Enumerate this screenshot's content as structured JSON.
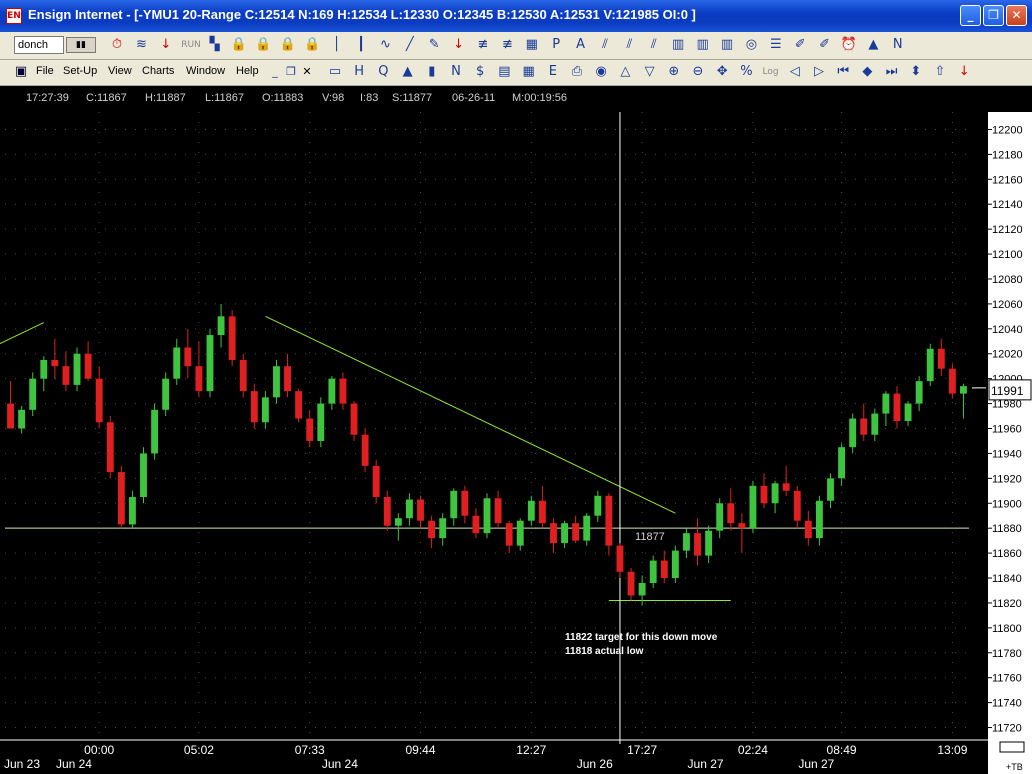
{
  "window": {
    "title": "Ensign Internet - [-YMU1 20-Range C:12514 N:169 H:12534 L:12330 O:12345 B:12530 A:12531 V:121985 OI:0 ]",
    "icon_text": "EN"
  },
  "toolbar1": {
    "symbol_value": "donch",
    "icons": [
      "stopwatch-icon",
      "wave-icon",
      "arrow-down-red-icon",
      "run-icon",
      "network-icon",
      "lock-icon",
      "lock-icon",
      "lock-icon",
      "lock-icon",
      "vertical-line-icon",
      "candle-icon",
      "curve-icon",
      "line-icon",
      "pencil-icon",
      "arrow-down-icon",
      "fib-icon",
      "fib-icon",
      "grid-icon",
      "p-box-icon",
      "a-box-icon",
      "lines-icon",
      "lines-icon",
      "lines-icon",
      "bars-icon",
      "bars-icon",
      "bars-icon",
      "target-icon",
      "list-icon",
      "pen-icon",
      "pen-icon",
      "alarm-icon",
      "triangle-icon",
      "n-icon"
    ],
    "run_label": "RUN"
  },
  "menubar": {
    "items": [
      "File",
      "Set-Up",
      "View",
      "Charts",
      "Window",
      "Help"
    ],
    "icons": [
      "window-icon",
      "h-icon",
      "q-icon",
      "fire-icon",
      "bar-icon",
      "n-icon",
      "dollar-icon",
      "book-icon",
      "grid-icon",
      "espl-icon",
      "print-icon",
      "color-icon",
      "triangle-up-icon",
      "triangle-down-icon",
      "zoom-in-icon",
      "zoom-out-icon",
      "drag-icon",
      "percent-icon",
      "log-icon",
      "scroll-left-icon",
      "scroll-right-icon",
      "first-icon",
      "arrows-lr-icon",
      "last-icon",
      "arrows-ud-icon",
      "arrow-up-icon",
      "arrow-down-icon"
    ],
    "log_label": "Log"
  },
  "infobar": {
    "time": "17:27:39",
    "close": "C:11867",
    "high": "H:11887",
    "low": "L:11867",
    "open": "O:11883",
    "volume": "V:98",
    "i": "I:83",
    "s": "S:11877",
    "date": "06-26-11",
    "m": "M:00:19:56"
  },
  "chart_data": {
    "type": "candlestick",
    "ylim": [
      11710,
      12210
    ],
    "y_ticks": [
      12200,
      12180,
      12160,
      12140,
      12120,
      12100,
      12080,
      12060,
      12040,
      12020,
      12000,
      11980,
      11960,
      11940,
      11920,
      11900,
      11880,
      11860,
      11840,
      11820,
      11800,
      11780,
      11760,
      11740,
      11720
    ],
    "time_labels": [
      {
        "bar": 8,
        "label": "00:00"
      },
      {
        "bar": 17,
        "label": "05:02"
      },
      {
        "bar": 27,
        "label": "07:33"
      },
      {
        "bar": 37,
        "label": "09:44"
      },
      {
        "bar": 47,
        "label": "12:27"
      },
      {
        "bar": 57,
        "label": "17:27"
      },
      {
        "bar": 67,
        "label": "02:24"
      },
      {
        "bar": 75,
        "label": "08:49"
      },
      {
        "bar": 85,
        "label": "13:09"
      }
    ],
    "date_labels": [
      {
        "bar": 0,
        "label": "Jun 23"
      },
      {
        "bar": 5,
        "label": "Jun 24"
      },
      {
        "bar": 29,
        "label": "Jun 24"
      },
      {
        "bar": 52,
        "label": "Jun 26"
      },
      {
        "bar": 62,
        "label": "Jun 27"
      },
      {
        "bar": 72,
        "label": "Jun 27"
      }
    ],
    "last_price": "11991",
    "crosshair_price": "11877",
    "corner_label": "+TB",
    "annotations": [
      "11822 target for this down move",
      "11818 actual low"
    ],
    "horizontal_lines": [
      11880,
      11822
    ],
    "trendlines": [
      {
        "from": [
          -1,
          12028
        ],
        "to": [
          3,
          12045
        ]
      },
      {
        "from": [
          23,
          12050
        ],
        "to": [
          60,
          11892
        ]
      }
    ],
    "colors": {
      "up": "#3ec43e",
      "down": "#e02020",
      "trend": "#8fe830",
      "hline": "#cfe8b0",
      "grid": "#4a4a4a",
      "text": "#ffffff"
    },
    "candles": [
      [
        11980,
        11998,
        11964,
        11960
      ],
      [
        11960,
        11978,
        11956,
        11975
      ],
      [
        11975,
        12005,
        11970,
        12000
      ],
      [
        12000,
        12018,
        11990,
        12015
      ],
      [
        12015,
        12032,
        12000,
        12010
      ],
      [
        12010,
        12022,
        11990,
        11995
      ],
      [
        11995,
        12025,
        11990,
        12020
      ],
      [
        12020,
        12030,
        11998,
        12000
      ],
      [
        12000,
        12010,
        11960,
        11965
      ],
      [
        11965,
        11970,
        11920,
        11925
      ],
      [
        11925,
        11930,
        11880,
        11883
      ],
      [
        11883,
        11910,
        11880,
        11905
      ],
      [
        11905,
        11945,
        11900,
        11940
      ],
      [
        11940,
        11980,
        11935,
        11975
      ],
      [
        11975,
        12005,
        11970,
        12000
      ],
      [
        12000,
        12032,
        11995,
        12025
      ],
      [
        12025,
        12040,
        12000,
        12010
      ],
      [
        12010,
        12030,
        11985,
        11990
      ],
      [
        11990,
        12040,
        11985,
        12035
      ],
      [
        12035,
        12060,
        12025,
        12050
      ],
      [
        12050,
        12055,
        12010,
        12015
      ],
      [
        12015,
        12020,
        11985,
        11990
      ],
      [
        11990,
        11996,
        11960,
        11965
      ],
      [
        11965,
        11990,
        11960,
        11985
      ],
      [
        11985,
        12015,
        11980,
        12010
      ],
      [
        12010,
        12020,
        11985,
        11990
      ],
      [
        11990,
        11992,
        11965,
        11968
      ],
      [
        11968,
        11975,
        11945,
        11950
      ],
      [
        11950,
        11985,
        11945,
        11980
      ],
      [
        11980,
        12002,
        11975,
        12000
      ],
      [
        12000,
        12005,
        11975,
        11980
      ],
      [
        11980,
        11982,
        11950,
        11955
      ],
      [
        11955,
        11960,
        11925,
        11930
      ],
      [
        11930,
        11935,
        11900,
        11905
      ],
      [
        11905,
        11910,
        11878,
        11882
      ],
      [
        11882,
        11892,
        11870,
        11888
      ],
      [
        11888,
        11908,
        11882,
        11903
      ],
      [
        11903,
        11906,
        11880,
        11886
      ],
      [
        11886,
        11890,
        11864,
        11872
      ],
      [
        11872,
        11892,
        11866,
        11888
      ],
      [
        11888,
        11912,
        11882,
        11910
      ],
      [
        11910,
        11914,
        11884,
        11890
      ],
      [
        11890,
        11896,
        11872,
        11876
      ],
      [
        11876,
        11908,
        11872,
        11904
      ],
      [
        11904,
        11910,
        11880,
        11884
      ],
      [
        11884,
        11886,
        11860,
        11866
      ],
      [
        11866,
        11888,
        11862,
        11886
      ],
      [
        11886,
        11906,
        11882,
        11902
      ],
      [
        11902,
        11914,
        11880,
        11884
      ],
      [
        11884,
        11888,
        11860,
        11868
      ],
      [
        11868,
        11886,
        11864,
        11884
      ],
      [
        11884,
        11890,
        11868,
        11870
      ],
      [
        11870,
        11892,
        11866,
        11890
      ],
      [
        11890,
        11910,
        11885,
        11906
      ],
      [
        11906,
        11908,
        11858,
        11866
      ],
      [
        11866,
        11868,
        11840,
        11845
      ],
      [
        11845,
        11848,
        11822,
        11826
      ],
      [
        11826,
        11842,
        11818,
        11836
      ],
      [
        11836,
        11858,
        11832,
        11854
      ],
      [
        11854,
        11862,
        11836,
        11840
      ],
      [
        11840,
        11866,
        11836,
        11862
      ],
      [
        11862,
        11880,
        11856,
        11876
      ],
      [
        11876,
        11888,
        11850,
        11858
      ],
      [
        11858,
        11882,
        11852,
        11878
      ],
      [
        11878,
        11904,
        11872,
        11900
      ],
      [
        11900,
        11912,
        11878,
        11884
      ],
      [
        11884,
        11892,
        11860,
        11880
      ],
      [
        11880,
        11918,
        11876,
        11914
      ],
      [
        11914,
        11924,
        11896,
        11900
      ],
      [
        11900,
        11918,
        11892,
        11916
      ],
      [
        11916,
        11930,
        11906,
        11910
      ],
      [
        11910,
        11914,
        11880,
        11886
      ],
      [
        11886,
        11894,
        11866,
        11872
      ],
      [
        11872,
        11906,
        11866,
        11902
      ],
      [
        11902,
        11924,
        11896,
        11920
      ],
      [
        11920,
        11948,
        11914,
        11945
      ],
      [
        11945,
        11972,
        11940,
        11968
      ],
      [
        11968,
        11980,
        11950,
        11955
      ],
      [
        11955,
        11976,
        11950,
        11972
      ],
      [
        11972,
        11990,
        11962,
        11988
      ],
      [
        11988,
        11994,
        11960,
        11966
      ],
      [
        11966,
        11982,
        11962,
        11980
      ],
      [
        11980,
        12002,
        11974,
        11998
      ],
      [
        11998,
        12028,
        11994,
        12024
      ],
      [
        12024,
        12032,
        12002,
        12008
      ],
      [
        12008,
        12012,
        11984,
        11988
      ],
      [
        11988,
        11996,
        11968,
        11994
      ]
    ]
  }
}
